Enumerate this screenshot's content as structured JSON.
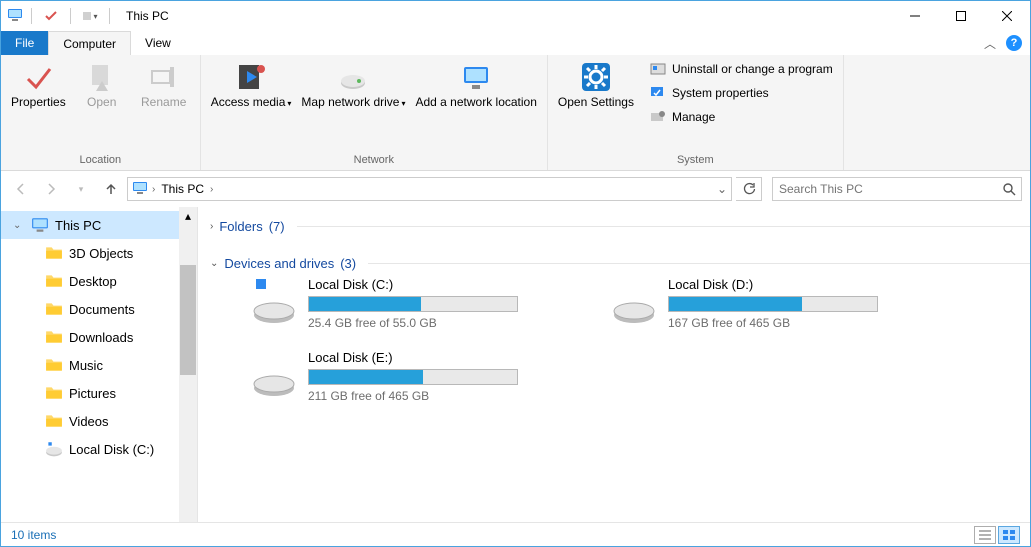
{
  "window": {
    "title": "This PC"
  },
  "ribbon": {
    "tabs": {
      "file": "File",
      "computer": "Computer",
      "view": "View"
    },
    "groups": {
      "location": {
        "label": "Location",
        "properties": "Properties",
        "open": "Open",
        "rename": "Rename"
      },
      "network": {
        "label": "Network",
        "access_media": "Access media",
        "map_drive": "Map network drive",
        "add_location": "Add a network location"
      },
      "system": {
        "label": "System",
        "open_settings": "Open Settings",
        "uninstall": "Uninstall or change a program",
        "sys_props": "System properties",
        "manage": "Manage"
      }
    }
  },
  "breadcrumb": {
    "root": "This PC"
  },
  "search": {
    "placeholder": "Search This PC"
  },
  "sidebar": {
    "items": [
      {
        "label": "This PC",
        "icon": "pc",
        "selected": true,
        "expandable": true
      },
      {
        "label": "3D Objects",
        "icon": "folder"
      },
      {
        "label": "Desktop",
        "icon": "folder"
      },
      {
        "label": "Documents",
        "icon": "folder"
      },
      {
        "label": "Downloads",
        "icon": "folder"
      },
      {
        "label": "Music",
        "icon": "folder"
      },
      {
        "label": "Pictures",
        "icon": "folder"
      },
      {
        "label": "Videos",
        "icon": "folder"
      },
      {
        "label": "Local Disk (C:)",
        "icon": "disk"
      }
    ]
  },
  "groups": {
    "folders": {
      "label": "Folders",
      "count": "(7)"
    },
    "drives": {
      "label": "Devices and drives",
      "count": "(3)"
    }
  },
  "drives": [
    {
      "name": "Local Disk (C:)",
      "free_text": "25.4 GB free of 55.0 GB",
      "fill_pct": 54,
      "os": true
    },
    {
      "name": "Local Disk (D:)",
      "free_text": "167 GB free of 465 GB",
      "fill_pct": 64,
      "os": false
    },
    {
      "name": "Local Disk (E:)",
      "free_text": "211 GB free of 465 GB",
      "fill_pct": 55,
      "os": false
    }
  ],
  "status": {
    "items": "10 items"
  }
}
